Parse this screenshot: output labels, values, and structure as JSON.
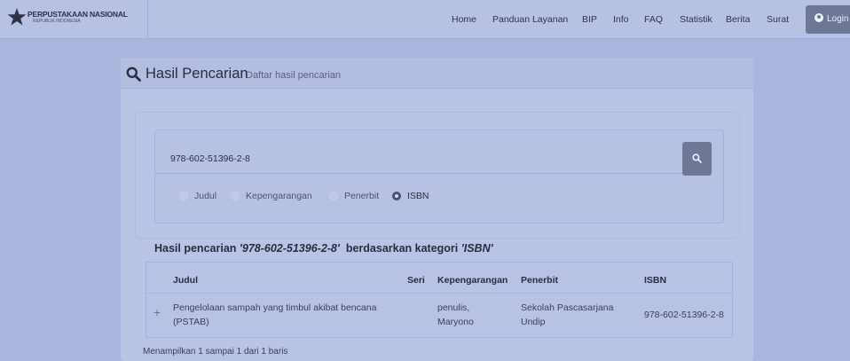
{
  "brand": {
    "name": "PERPUSTAKAAN NASIONAL",
    "sub": "REPUBLIK INDONESIA"
  },
  "nav": [
    {
      "key": "home",
      "label": "Home"
    },
    {
      "key": "panduan",
      "label": "Panduan Layanan"
    },
    {
      "key": "bip",
      "label": "BIP"
    },
    {
      "key": "info",
      "label": "Info"
    },
    {
      "key": "faq",
      "label": "FAQ"
    },
    {
      "key": "statistik",
      "label": "Statistik"
    },
    {
      "key": "berita",
      "label": "Berita"
    },
    {
      "key": "surat",
      "label": "Surat"
    }
  ],
  "login_label": "Login",
  "page": {
    "title": "Hasil Pencarian",
    "subtitle": "Daftar hasil pencarian"
  },
  "search": {
    "value": "978-602-51396-2-8",
    "icon": "search-icon",
    "options": [
      {
        "label": "Judul",
        "selected": false
      },
      {
        "label": "Kepengarangan",
        "selected": false
      },
      {
        "label": "Penerbit",
        "selected": false
      },
      {
        "label": "ISBN",
        "selected": true
      }
    ]
  },
  "results": {
    "prefix": "Hasil pencarian",
    "query": "'978-602-51396-2-8'",
    "middle": "berdasarkan kategori",
    "category": "'ISBN'",
    "headers": {
      "judul": "Judul",
      "seri": "Seri",
      "kepengarangan": "Kepengarangan",
      "penerbit": "Penerbit",
      "isbn": "ISBN"
    },
    "rows": [
      {
        "judul": "Pengelolaan sampah yang timbul akibat bencana (PSTAB)",
        "seri": "",
        "kepengarangan": "penulis, Maryono",
        "penerbit": "Sekolah Pascasarjana Undip",
        "isbn": "978-602-51396-2-8"
      }
    ],
    "count_text": "Menampilkan 1 sampai 1 dari 1 baris"
  },
  "colors": {
    "topbar": "#b7c1e4",
    "background": "#aab6de",
    "button": "#6e7896"
  }
}
